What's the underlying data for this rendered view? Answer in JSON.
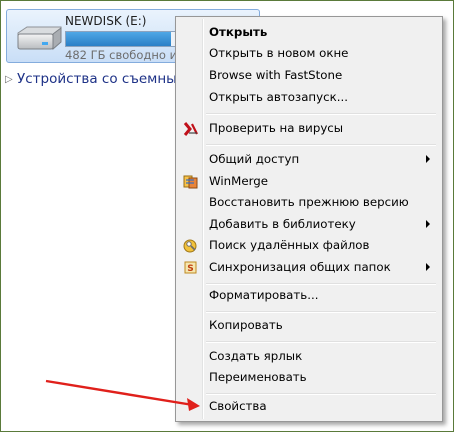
{
  "drive": {
    "name": "NEWDISK (E:)",
    "free_text": "482 ГБ свободно из",
    "used_fraction": 0.55,
    "icon": "hard-drive-icon"
  },
  "section": {
    "label": "Устройства со съемны",
    "icon": "expand-chevron-icon"
  },
  "menu": {
    "items": [
      {
        "label": "Открыть",
        "bold": true
      },
      {
        "label": "Открыть в новом окне"
      },
      {
        "label": "Browse with FastStone"
      },
      {
        "label": "Открыть автозапуск..."
      },
      {
        "label": "Проверить на вирусы",
        "icon": "kaspersky-icon"
      },
      {
        "label": "Общий доступ",
        "submenu": true
      },
      {
        "label": "WinMerge",
        "icon": "winmerge-icon"
      },
      {
        "label": "Восстановить прежнюю версию"
      },
      {
        "label": "Добавить в библиотеку",
        "submenu": true
      },
      {
        "label": "Поиск удалённых файлов",
        "icon": "file-recovery-icon"
      },
      {
        "label": "Синхронизация общих папок",
        "icon": "sync-folders-icon",
        "submenu": true
      },
      {
        "label": "Форматировать..."
      },
      {
        "label": "Копировать"
      },
      {
        "label": "Создать ярлык"
      },
      {
        "label": "Переименовать"
      },
      {
        "label": "Свойства"
      }
    ]
  },
  "annotation": {
    "arrow_color": "#e0201b",
    "icon": "red-arrow-icon"
  }
}
